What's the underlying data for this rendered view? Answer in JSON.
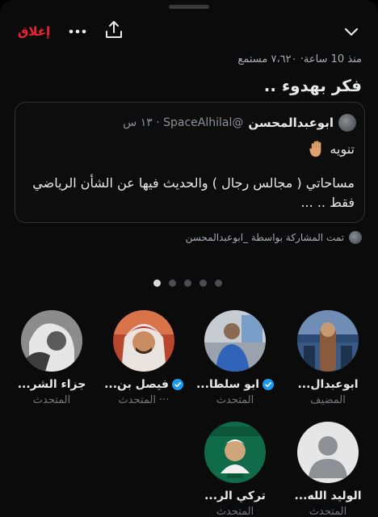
{
  "header": {
    "close_label": "إغلاق",
    "more_icon": "more-horizontal-icon",
    "share_icon": "share-icon",
    "collapse_icon": "chevron-down-icon"
  },
  "space": {
    "meta": "منذ 10 ساعة· ٧،٦٢٠ مستمع",
    "title": "فكر بهدوء .."
  },
  "pinned_tweet": {
    "author": "ابوعبدالمحسن",
    "handle_time": "@SpaceAlhilal · ١٣ س",
    "line1": "تنويه",
    "line1_icon": "raised-hand-emoji",
    "body": "مساحاتي ( مجالس رجال ) والحديث فيها عن الشأن الرياضي فقط .. ..."
  },
  "shared_by": "تمت المشاركة بواسطة ‏_ابوعبدالمحسن",
  "pager": {
    "count": 5,
    "active_index": 0
  },
  "speakers": [
    {
      "name": "ابوعبدال...",
      "role": "المضيف",
      "verified": false,
      "avatar": "avatar-photo-stadium"
    },
    {
      "name": "ابو سلطا...",
      "role": "المتحدث",
      "verified": true,
      "avatar": "avatar-photo-man-blue"
    },
    {
      "name": "فيصل بن...",
      "role": "··· المتحدث",
      "verified": true,
      "avatar": "avatar-photo-man-shemagh"
    },
    {
      "name": "جزاء الشر...",
      "role": "المتحدث",
      "verified": false,
      "avatar": "avatar-photo-bw"
    },
    {
      "name": "الوليد الله...",
      "role": "المتحدث",
      "verified": false,
      "avatar": "default-avatar"
    },
    {
      "name": "تركي الر...",
      "role": "المتحدث",
      "verified": false,
      "avatar": "avatar-ksa-logo"
    }
  ],
  "colors": {
    "accent_red": "#f4212e",
    "verified_blue": "#1d9bf0",
    "background": "#0b0b0b"
  }
}
